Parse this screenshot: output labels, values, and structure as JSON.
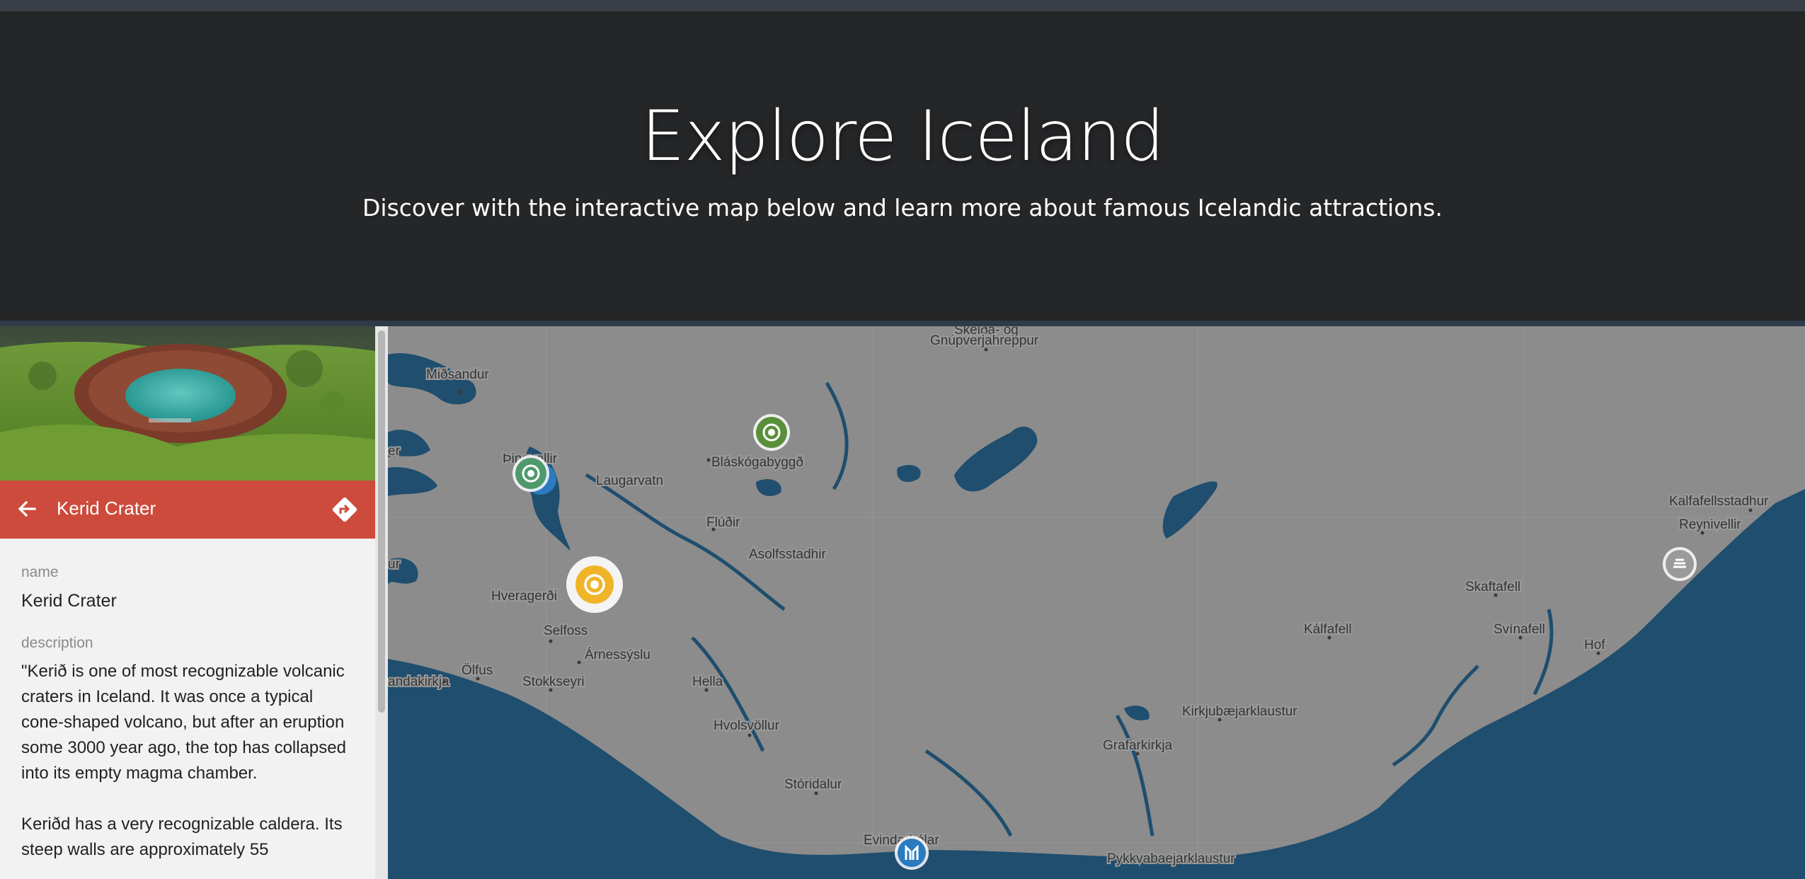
{
  "hero": {
    "title": "Explore Iceland",
    "subtitle": "Discover with the interactive map below and learn more about famous Icelandic attractions."
  },
  "sidebar": {
    "header_title": "Kerid Crater",
    "back_icon": "arrow-left-icon",
    "directions_icon": "directions-icon",
    "accent_color": "#cd4b3c",
    "fields": {
      "name_label": "name",
      "name_value": "Kerid Crater",
      "description_label": "description",
      "description_value": "\"Kerið is one of most recognizable volcanic craters in Iceland. It was once a typical cone-shaped volcano, but after an eruption some 3000 year ago, the top has collapsed into its empty magma chamber.\n\nKeriðd has a very recognizable caldera. Its steep walls are approximately 55"
    }
  },
  "map": {
    "land_color": "#8c8c8c",
    "water_color": "#1f4e6e",
    "places": [
      "Skeiða- og",
      "Gnúpverjahreppur",
      "Miðsandur",
      "Bláskógabyggð",
      "Þingvellir",
      "Laugarvatn",
      "Flúðir",
      "Asolfsstadhir",
      "Hveragerði",
      "Selfoss",
      "Árnessýslu",
      "Ölfus",
      "Stokkseyri",
      "Hella",
      "Hvolsvöllur",
      "Stóridalur",
      "Evindarhólar",
      "Pykkvabaejarklaustur",
      "Grafarkirkja",
      "Kirkjubæjarklaustur",
      "Kálfafell",
      "Skaftafell",
      "Svínafell",
      "Hof",
      "Reynivellir",
      "Kalfafellsstadhur",
      "andakirkja",
      "er",
      "ur"
    ],
    "markers": [
      {
        "name": "green-marker",
        "color": "#5a8f3a"
      },
      {
        "name": "green-marker",
        "color": "#4e9a6c"
      },
      {
        "name": "yellow-marker",
        "color": "#f0b429"
      },
      {
        "name": "blue-marker",
        "color": "#2a7bbf"
      },
      {
        "name": "grey-marker",
        "color": "#9a9a9a"
      }
    ]
  }
}
